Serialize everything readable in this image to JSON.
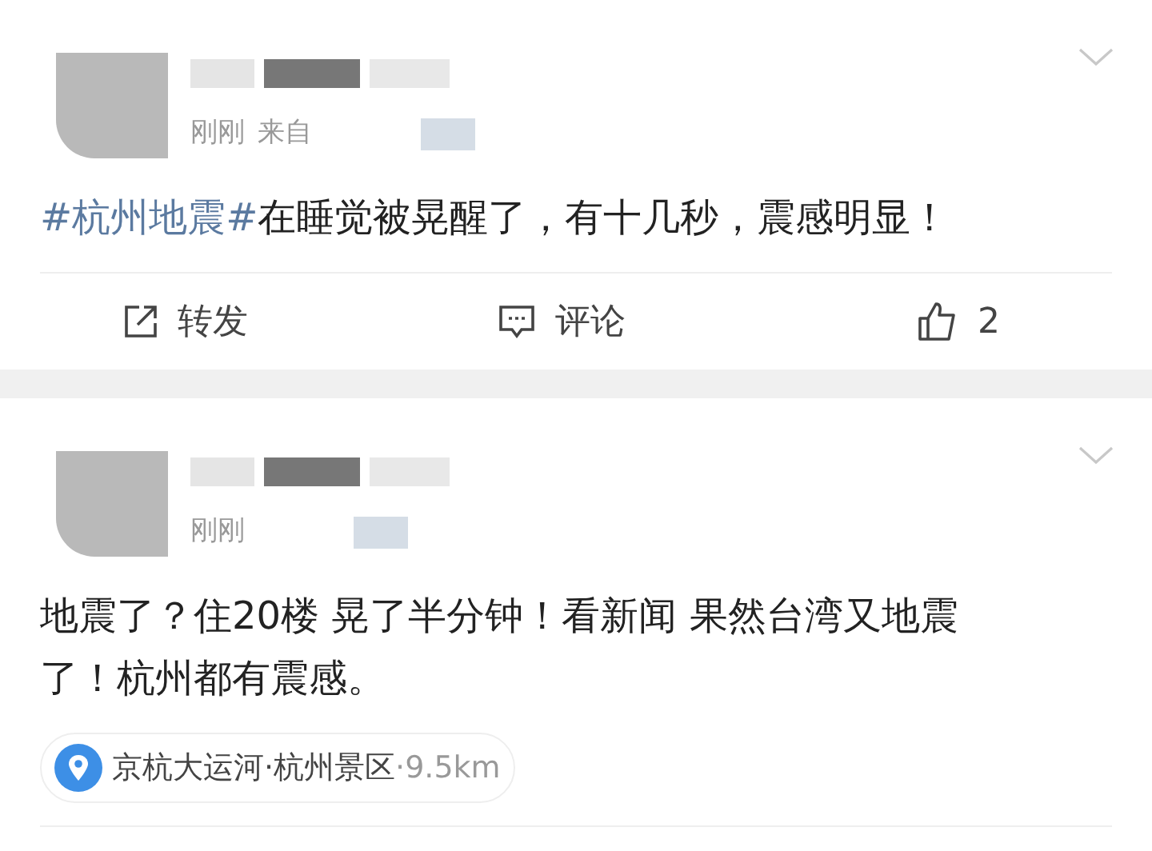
{
  "posts": [
    {
      "meta": [
        "刚刚",
        "来自"
      ],
      "hashtag": "#杭州地震#",
      "text": "在睡觉被晃醒了，有十几秒，震感明显！",
      "actions": [
        {
          "kind": "repost",
          "label": "转发"
        },
        {
          "kind": "comment",
          "label": "评论"
        },
        {
          "kind": "like",
          "label": "2"
        }
      ]
    },
    {
      "meta": [
        "刚刚"
      ],
      "text": "地震了？住20楼 晃了半分钟！看新闻 果然台湾又地震了！杭州都有震感。",
      "location": {
        "name": "京杭大运河·杭州景区",
        "distance": "·9.5km"
      }
    }
  ]
}
